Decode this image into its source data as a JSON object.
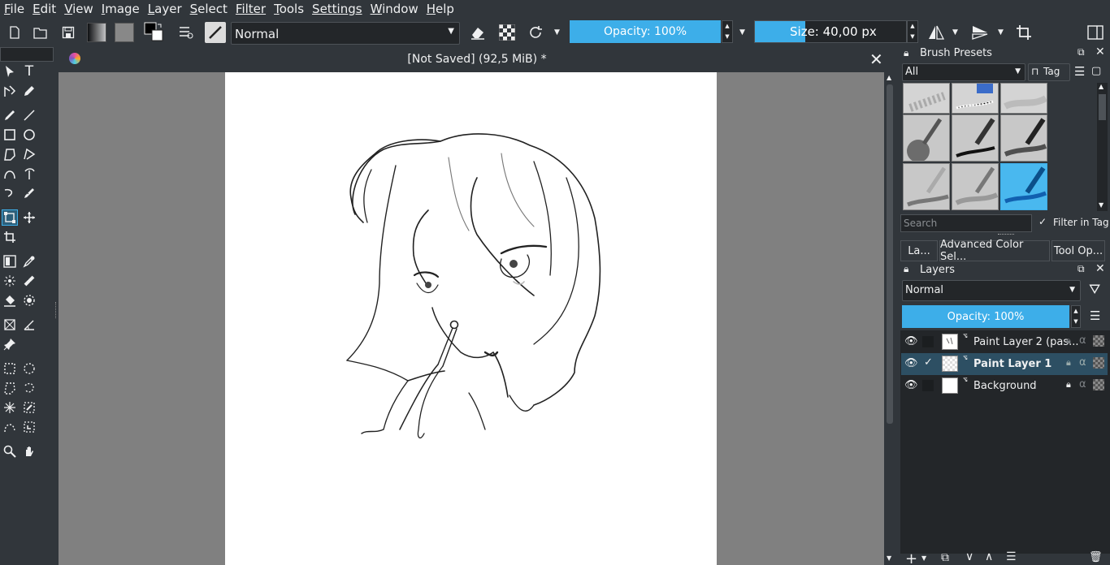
{
  "menubar": {
    "items": [
      {
        "label": "File",
        "ul": "F",
        "rest": "ile"
      },
      {
        "label": "Edit",
        "ul": "E",
        "rest": "dit"
      },
      {
        "label": "View",
        "ul": "V",
        "rest": "iew"
      },
      {
        "label": "Image",
        "ul": "I",
        "rest": "mage"
      },
      {
        "label": "Layer",
        "ul": "L",
        "rest": "ayer"
      },
      {
        "label": "Select",
        "ul": "S",
        "rest": "elect"
      },
      {
        "label": "Filter",
        "ul": "",
        "rest": "Filter"
      },
      {
        "label": "Tools",
        "ul": "T",
        "rest": "ools"
      },
      {
        "label": "Settings",
        "ul": "",
        "rest": "Settings"
      },
      {
        "label": "Window",
        "ul": "W",
        "rest": "indow"
      },
      {
        "label": "Help",
        "ul": "H",
        "rest": "elp"
      }
    ]
  },
  "toolbar": {
    "blend_mode": "Normal",
    "opacity_label": "Opacity: 100%",
    "size_label": "Size: 40,00 px",
    "opacity_value": 1.0,
    "size_fill_fraction": 0.33
  },
  "document": {
    "title": "[Not Saved]  (92,5 MiB) *"
  },
  "brush_presets": {
    "title": "Brush Presets",
    "filter_value": "All",
    "tag_label": "Tag",
    "search_placeholder": "Search",
    "filter_in_tag_label": "Filter in Tag"
  },
  "dock_tabs": [
    "La...",
    "Advanced Color Sel...",
    "Tool Op..."
  ],
  "layers": {
    "title": "Layers",
    "blend_mode": "Normal",
    "opacity_label": "Opacity:  100%",
    "items": [
      {
        "name": "Paint Layer 2 (pas...",
        "active": false
      },
      {
        "name": "Paint Layer 1",
        "active": true
      },
      {
        "name": "Background",
        "active": false
      }
    ]
  },
  "colors": {
    "accent": "#3daee9",
    "bg": "#31363b",
    "canvas_bg": "#808080",
    "selected_row": "#2d4f63"
  }
}
